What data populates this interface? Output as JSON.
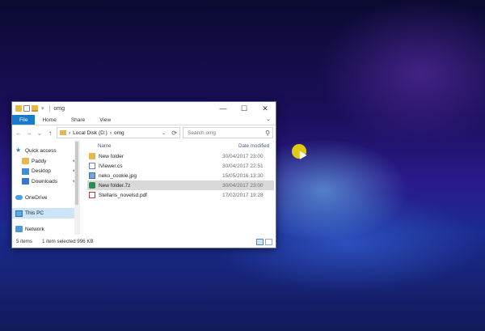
{
  "window": {
    "title": "omg",
    "controls": {
      "minimize": "—",
      "maximize": "☐",
      "close": "✕"
    }
  },
  "ribbon": {
    "tabs": [
      "File",
      "Home",
      "Share",
      "View"
    ],
    "expand_glyph": "⌄"
  },
  "navigation": {
    "back": "←",
    "forward": "→",
    "recent": "⌄",
    "up": "↑",
    "breadcrumb": [
      "Local Disk (D:)",
      "omg"
    ],
    "breadcrumb_sep": "›",
    "refresh": "⟳",
    "search_placeholder": "Search omg"
  },
  "sidebar": {
    "items": [
      {
        "label": "Quick access",
        "icon": "star-icon",
        "pinned": false
      },
      {
        "label": "Paddy",
        "icon": "user-folder-icon",
        "pinned": true
      },
      {
        "label": "Desktop",
        "icon": "desktop-icon",
        "pinned": true
      },
      {
        "label": "Downloads",
        "icon": "download-icon",
        "pinned": true
      },
      {
        "label": "OneDrive",
        "icon": "cloud-icon",
        "pinned": false
      },
      {
        "label": "This PC",
        "icon": "computer-icon",
        "pinned": false,
        "selected": true
      },
      {
        "label": "Network",
        "icon": "network-icon",
        "pinned": false
      }
    ],
    "pin_glyph": "📌"
  },
  "files": {
    "columns": {
      "name": "Name",
      "date": "Date modified"
    },
    "rows": [
      {
        "name": "New folder",
        "date": "30/04/2017 23:00",
        "icon": "folder-icon"
      },
      {
        "name": "IViewer.cs",
        "date": "30/04/2017 22:51",
        "icon": "cs-file-icon"
      },
      {
        "name": "neko_cookie.jpg",
        "date": "15/05/2016 13:30",
        "icon": "image-file-icon"
      },
      {
        "name": "New folder.7z",
        "date": "30/04/2017 23:00",
        "icon": "archive-7z-icon",
        "selected": true
      },
      {
        "name": "Stellaris_novelsd.pdf",
        "date": "17/02/2017 19:28",
        "icon": "pdf-file-icon"
      }
    ]
  },
  "status": {
    "count": "5 items",
    "selection": "1 item selected  996 KB"
  }
}
